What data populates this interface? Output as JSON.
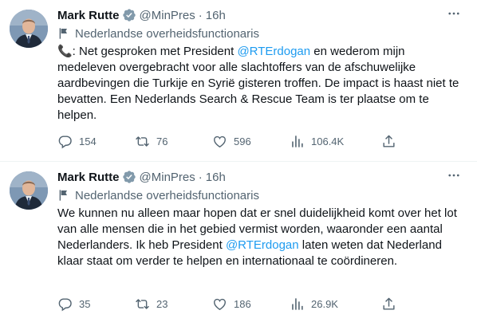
{
  "tweets": [
    {
      "author_name": "Mark Rutte",
      "handle": "@MinPres",
      "separator": "·",
      "time": "16h",
      "label": "Nederlandse overheidsfunctionaris",
      "text_parts": [
        "📞: Net gesproken met President ",
        "@RTErdogan",
        " en wederom mijn medeleven overgebracht voor alle slachtoffers van de afschuwelijke aardbevingen die Turkije en Syrië gisteren troffen. De impact is haast niet te bevatten. Een Nederlands Search & Rescue Team is ter plaatse om te helpen."
      ],
      "counts": {
        "replies": "154",
        "retweets": "76",
        "likes": "596",
        "views": "106.4K"
      }
    },
    {
      "author_name": "Mark Rutte",
      "handle": "@MinPres",
      "separator": "·",
      "time": "16h",
      "label": "Nederlandse overheidsfunctionaris",
      "text_parts": [
        "We kunnen nu alleen maar hopen dat er snel duidelijkheid komt over het lot van alle mensen die in het gebied vermist worden, waaronder een aantal Nederlanders. Ik heb President ",
        "@RTErdogan",
        " laten weten dat Nederland klaar staat om verder te helpen en internationaal te coördineren."
      ],
      "counts": {
        "replies": "35",
        "retweets": "23",
        "likes": "186",
        "views": "26.9K"
      }
    }
  ],
  "colors": {
    "accent": "#1d9bf0",
    "secondary_text": "#536471",
    "text": "#0f1419",
    "divider": "#eff3f4"
  },
  "icons": [
    "verified-badge-icon",
    "more-options-icon",
    "government-flag-icon",
    "reply-icon",
    "retweet-icon",
    "like-icon",
    "views-icon",
    "share-icon"
  ]
}
